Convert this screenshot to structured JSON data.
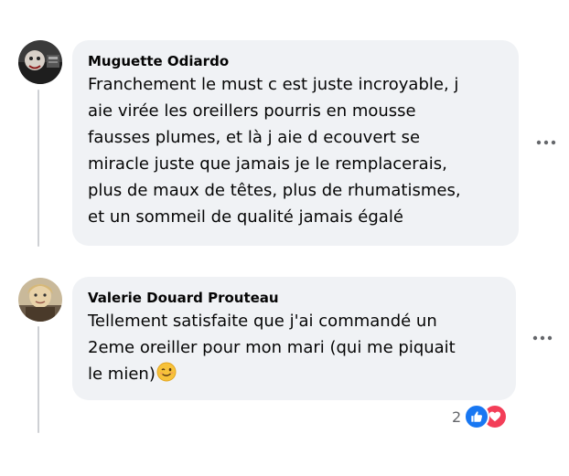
{
  "comments": [
    {
      "author": "Muguette Odiardo",
      "lines": [
        "Franchement le must c est juste incroyable, j",
        "aie virée les oreillers pourris en mousse",
        "fausses plumes, et là j aie d ecouvert se",
        "miracle juste que jamais je le remplacerais,",
        "plus de maux de têtes, plus de rhumatismes,",
        "et un sommeil de qualité jamais égalé"
      ],
      "more_icon": "more-horizontal-icon"
    },
    {
      "author": "Valerie Douard Prouteau",
      "lines": [
        "Tellement satisfaite que j'ai commandé un",
        "2eme oreiller pour mon mari (qui me piquait",
        "le mien)"
      ],
      "emoji": "winking-face-emoji",
      "reactions": {
        "count": "2",
        "types": [
          "like-icon",
          "love-icon"
        ],
        "colors": {
          "like": "#1877f2",
          "love": "#f33e58"
        }
      },
      "more_icon": "more-horizontal-icon"
    }
  ],
  "colors": {
    "bubble": "#f0f2f5",
    "thread_line": "#ced0d4",
    "secondary_text": "#65676b"
  }
}
